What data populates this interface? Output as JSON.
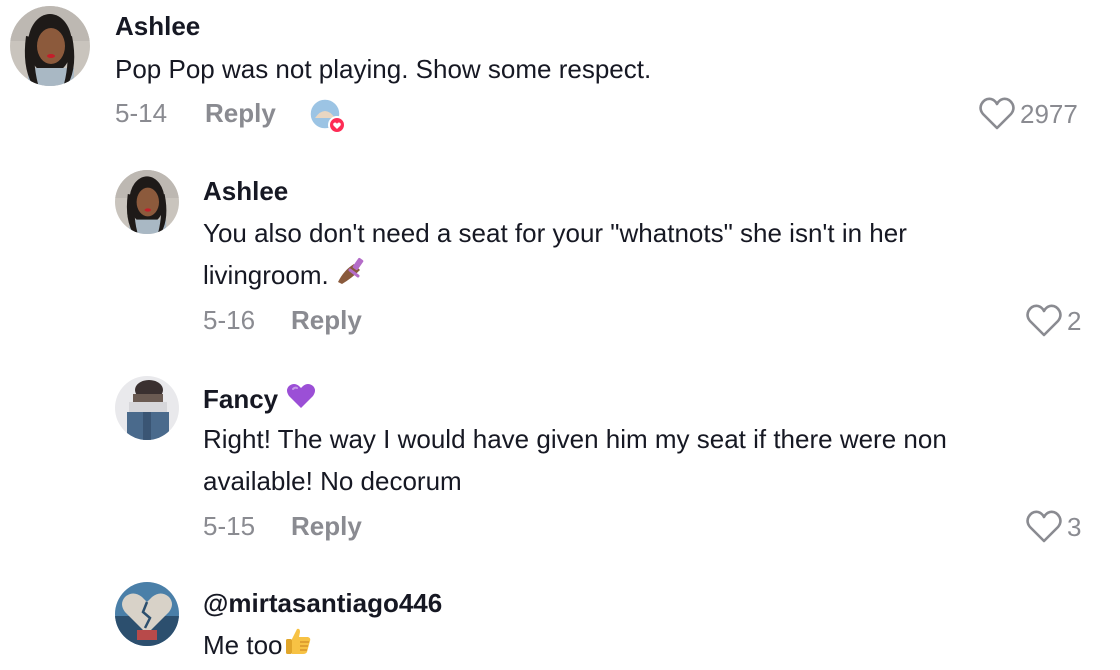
{
  "comments": [
    {
      "username": "Ashlee",
      "text_lines": [
        "Pop Pop was not playing. Show some respect."
      ],
      "date": "5-14",
      "reply_label": "Reply",
      "like_count": "2977",
      "avatar_icon": "woman-portrait",
      "creator_liked_badge": "creator-liked-avatar"
    },
    {
      "username": "Ashlee",
      "text_lines": [
        "You also don't need a seat for your \"whatnots\" she isn't in her",
        "livingroom."
      ],
      "trailing_emoji": "nail-polish-emoji",
      "date": "5-16",
      "reply_label": "Reply",
      "like_count": "2",
      "avatar_icon": "woman-portrait"
    },
    {
      "username": "Fancy",
      "username_emoji": "purple-heart-emoji",
      "text_lines": [
        "Right! The way I would have given him my seat if there were non",
        "available! No decorum"
      ],
      "date": "5-15",
      "reply_label": "Reply",
      "like_count": "3",
      "avatar_icon": "person-photo"
    },
    {
      "username": "@mirtasantiago446",
      "text_lines": [
        "Me too"
      ],
      "trailing_emoji": "thumbs-up-emoji",
      "avatar_icon": "broken-heart-art"
    }
  ],
  "colors": {
    "text_primary": "#161823",
    "text_secondary": "#8a8b91",
    "heart_outline": "#8a8b91",
    "badge_red": "#fe2c55"
  }
}
